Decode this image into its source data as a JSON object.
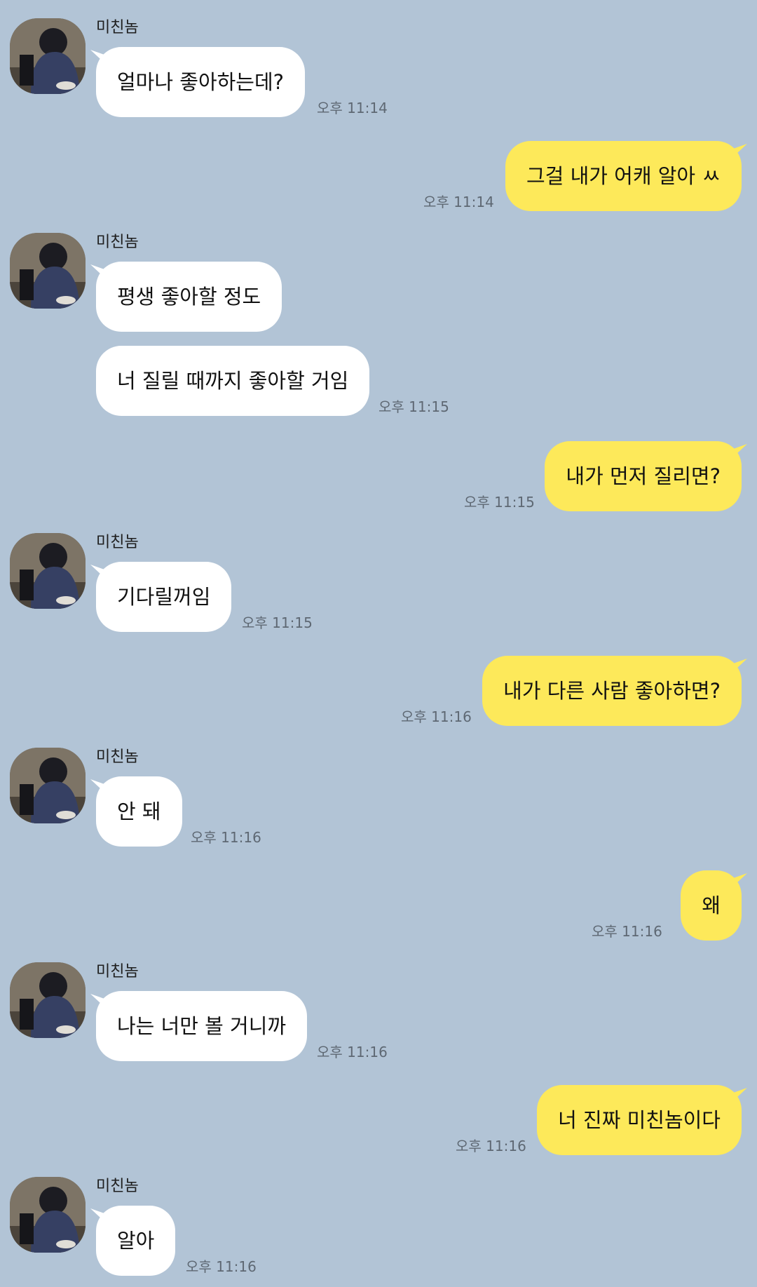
{
  "contact": {
    "name": "미친놈"
  },
  "messages": [
    {
      "sender": "them",
      "text": "얼마나 좋아하는데?",
      "time": "오후 11:14"
    },
    {
      "sender": "me",
      "text": "그걸 내가 어캐 알아 ㅆ",
      "time": "오후 11:14"
    },
    {
      "sender": "them",
      "text": "평생 좋아할 정도",
      "time": ""
    },
    {
      "sender": "them",
      "text": "너 질릴 때까지 좋아할 거임",
      "time": "오후 11:15"
    },
    {
      "sender": "me",
      "text": "내가 먼저 질리면?",
      "time": "오후 11:15"
    },
    {
      "sender": "them",
      "text": "기다릴꺼임",
      "time": "오후 11:15"
    },
    {
      "sender": "me",
      "text": "내가 다른 사람 좋아하면?",
      "time": "오후 11:16"
    },
    {
      "sender": "them",
      "text": "안 돼",
      "time": "오후 11:16"
    },
    {
      "sender": "me",
      "text": "왜",
      "time": "오후 11:16"
    },
    {
      "sender": "them",
      "text": "나는 너만 볼 거니까",
      "time": "오후 11:16"
    },
    {
      "sender": "me",
      "text": "너 진짜 미친놈이다",
      "time": "오후 11:16"
    },
    {
      "sender": "them",
      "text": "알아",
      "time": "오후 11:16"
    }
  ],
  "colors": {
    "background": "#b2c4d6",
    "incoming_bubble": "#ffffff",
    "outgoing_bubble": "#fde95a",
    "timestamp": "#5e6873"
  },
  "icons": {
    "avatar": "profile-photo"
  }
}
